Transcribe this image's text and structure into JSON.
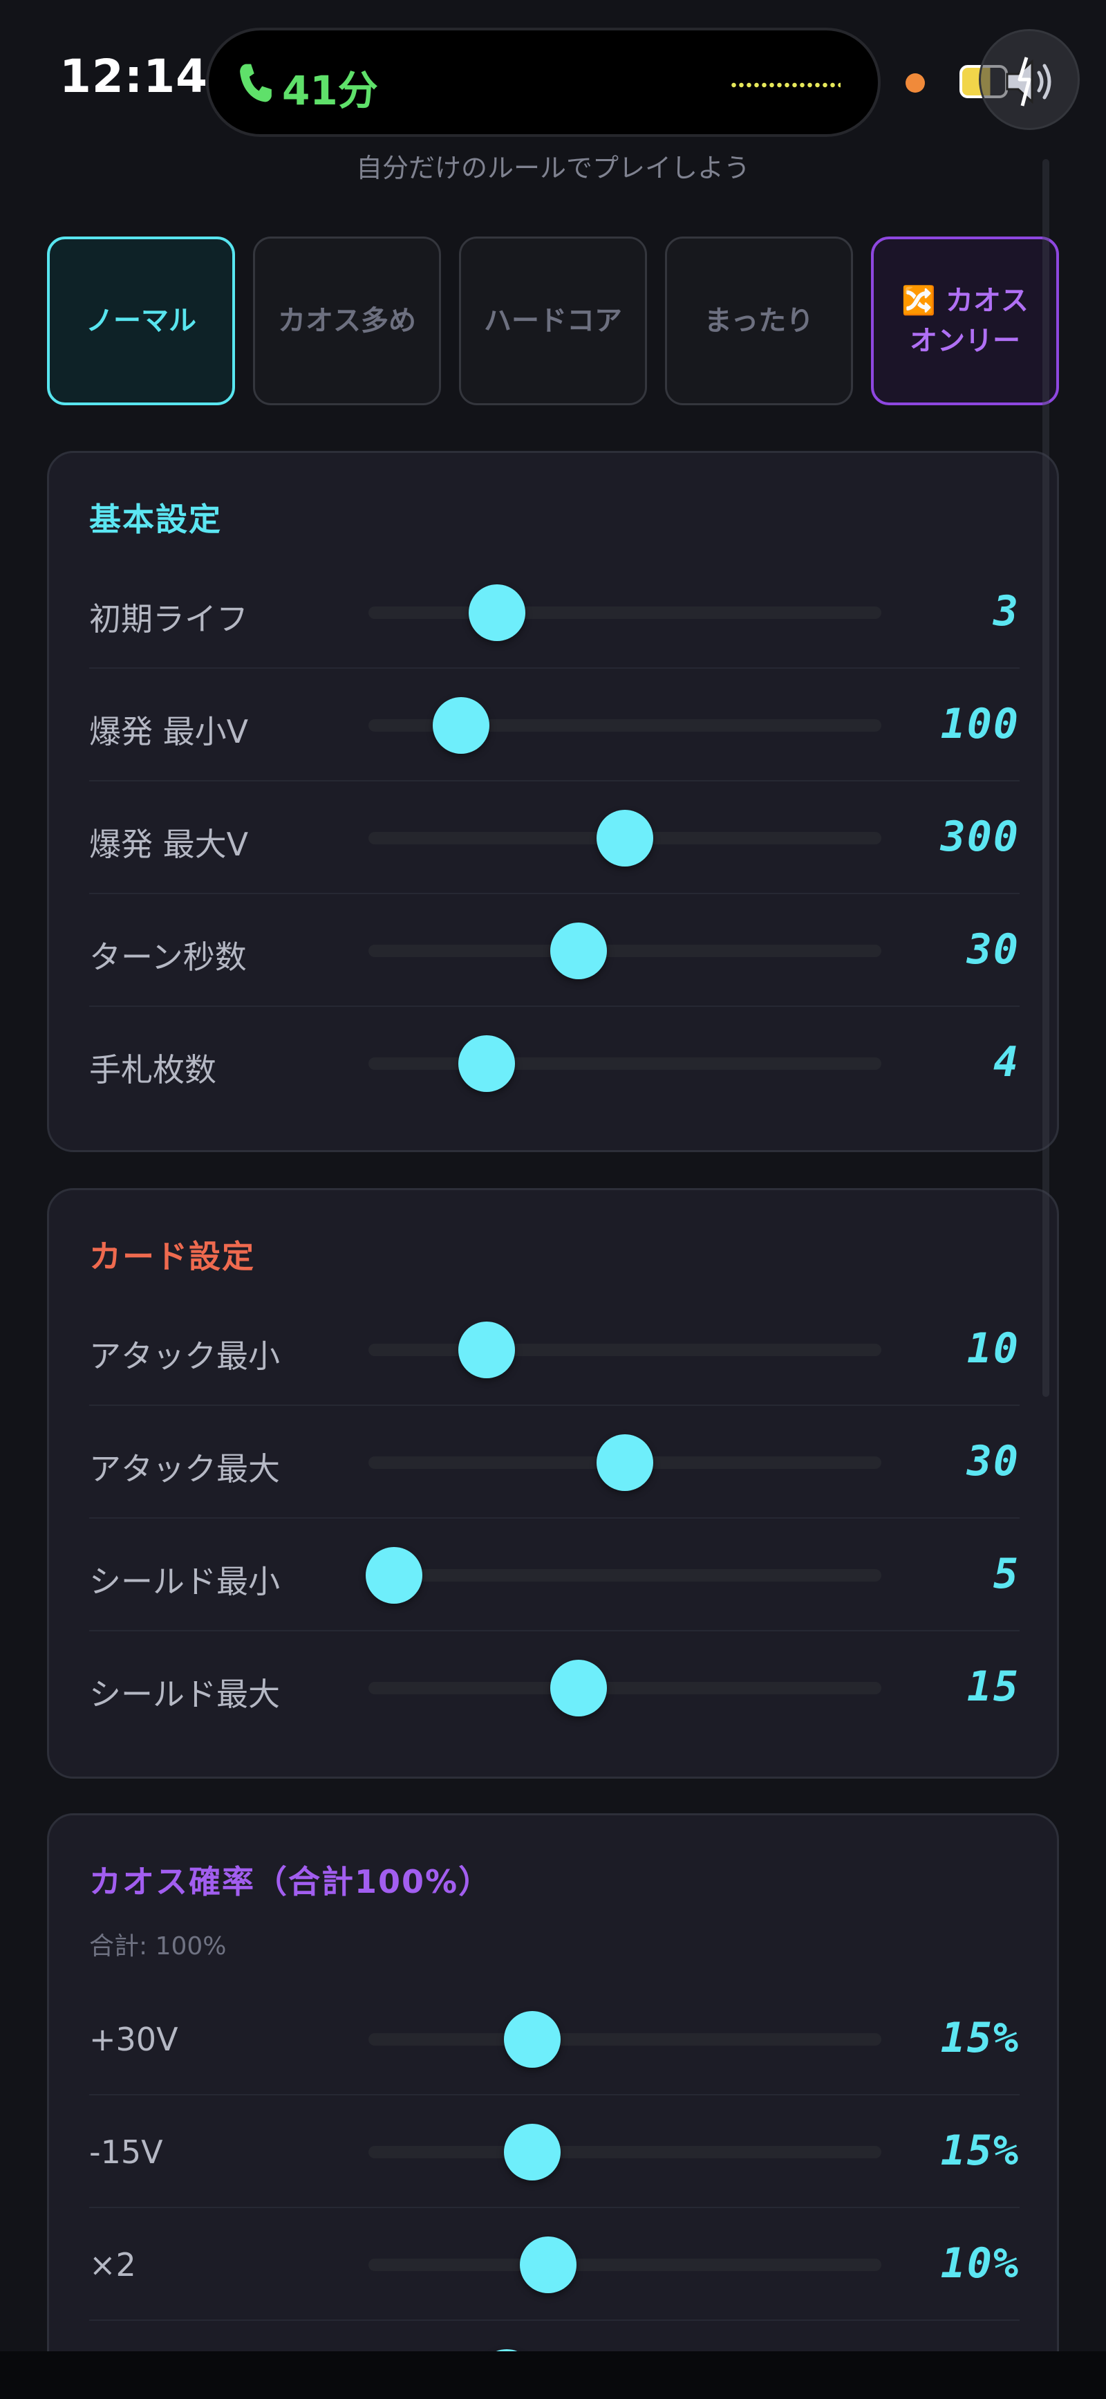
{
  "status": {
    "time": "12:14",
    "call_text": "41分"
  },
  "subtitle": "自分だけのルールでプレイしよう",
  "presets": [
    {
      "label": "ノーマル",
      "state": "active"
    },
    {
      "label": "カオス多め",
      "state": "normal"
    },
    {
      "label": "ハードコア",
      "state": "normal"
    },
    {
      "label": "まったり",
      "state": "normal"
    },
    {
      "label": "🔀 カオスオンリー",
      "state": "chaos"
    }
  ],
  "basic": {
    "title": "基本設定",
    "title_color": "#5ce6f2",
    "rows": [
      {
        "label": "初期ライフ",
        "value": "3",
        "level": 0.25
      },
      {
        "label": "爆発 最小V",
        "value": "100",
        "level": 0.18
      },
      {
        "label": "爆発 最大V",
        "value": "300",
        "level": 0.5
      },
      {
        "label": "ターン秒数",
        "value": "30",
        "level": 0.41
      },
      {
        "label": "手札枚数",
        "value": "4",
        "level": 0.23
      }
    ]
  },
  "card": {
    "title": "カード設定",
    "title_color": "#ef6a4f",
    "rows": [
      {
        "label": "アタック最小",
        "value": "10",
        "level": 0.23
      },
      {
        "label": "アタック最大",
        "value": "30",
        "level": 0.5
      },
      {
        "label": "シールド最小",
        "value": "5",
        "level": 0.05
      },
      {
        "label": "シールド最大",
        "value": "15",
        "level": 0.41
      }
    ]
  },
  "chaos": {
    "title": "カオス確率（合計100%）",
    "title_color": "#a25ef0",
    "total": "合計: 100%",
    "rows": [
      {
        "label": "+30V",
        "value": "15%",
        "level": 0.32
      },
      {
        "label": "-15V",
        "value": "15%",
        "level": 0.32
      },
      {
        "label": "×2",
        "value": "10%",
        "level": 0.35
      },
      {
        "label": "",
        "value": "",
        "level": 0.27
      }
    ]
  },
  "colors": {
    "accent_cyan": "#5ce6f2",
    "accent_purple": "#a25ef0",
    "accent_orange": "#ef6a4f"
  }
}
